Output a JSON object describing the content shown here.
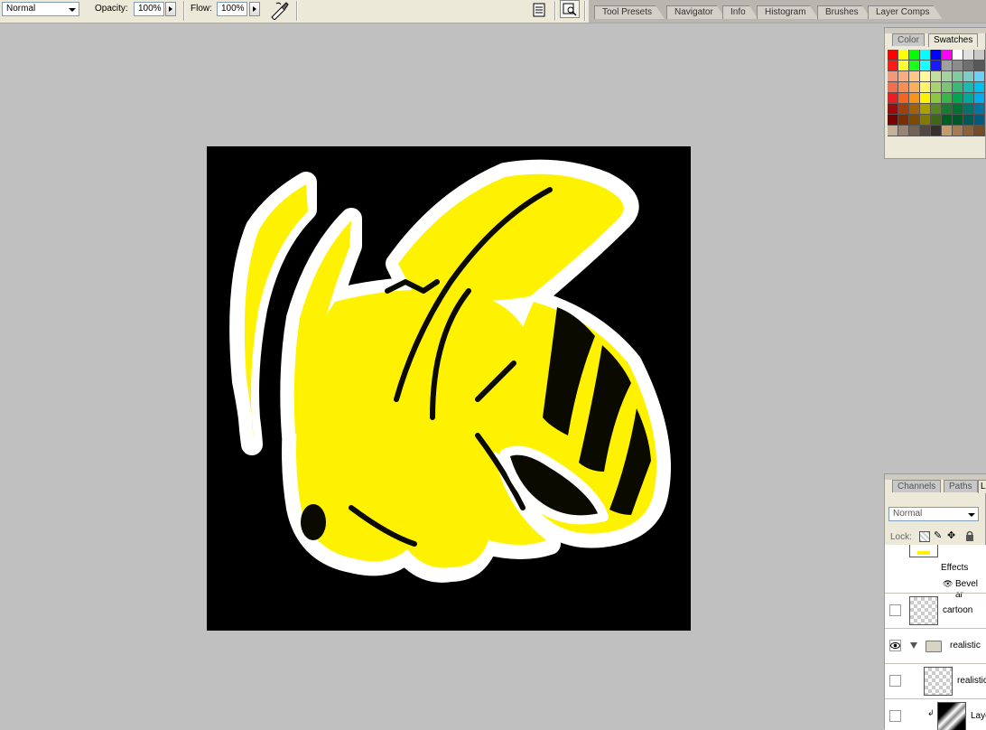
{
  "options_bar": {
    "mode_value": "Normal",
    "opacity_label": "Opacity:",
    "opacity_value": "100%",
    "flow_label": "Flow:",
    "flow_value": "100%",
    "icons": [
      "airbrush-icon",
      "palette-toggle-icon",
      "file-browser-icon"
    ]
  },
  "palette_well": {
    "tabs": [
      "Tool Presets",
      "Navigator",
      "Info",
      "Histogram",
      "Brushes",
      "Layer Comps"
    ]
  },
  "document": {
    "background": "#000000",
    "artwork": "bee-illustration"
  },
  "color_panel": {
    "tabs": [
      "Color",
      "Swatches"
    ],
    "active_tab": "Swatches",
    "swatches": [
      [
        "#ff0000",
        "#ffff00",
        "#00ff00",
        "#00ffff",
        "#0000ff",
        "#ff00ff",
        "#ffffff",
        "#e0e0e0",
        "#c8c8c8"
      ],
      [
        "#ff1a1a",
        "#ffff33",
        "#1aff1a",
        "#1affff",
        "#1a1aff",
        "#a0a0a0",
        "#8c8c8c",
        "#707070",
        "#585858"
      ],
      [
        "#f7977a",
        "#fbad82",
        "#fdc68a",
        "#fff79a",
        "#c4df9b",
        "#a2d39c",
        "#82ca9d",
        "#7bcdc8",
        "#6ecff6"
      ],
      [
        "#f26c4f",
        "#f68e55",
        "#fbaf5c",
        "#fff467",
        "#acd372",
        "#7cc576",
        "#3bb878",
        "#1abbb4",
        "#00bff3"
      ],
      [
        "#ed1c24",
        "#f26522",
        "#f7941d",
        "#fff200",
        "#8dc73f",
        "#39b54a",
        "#00a651",
        "#00a99d",
        "#00aeef"
      ],
      [
        "#9e0b0f",
        "#a0410d",
        "#a36209",
        "#aba000",
        "#598527",
        "#1a7b30",
        "#007236",
        "#00746b",
        "#0076a3"
      ],
      [
        "#790000",
        "#7b2e00",
        "#7d4900",
        "#827b00",
        "#406618",
        "#005e20",
        "#005826",
        "#005952",
        "#005b7f"
      ],
      [
        "#c7b299",
        "#998675",
        "#736357",
        "#534741",
        "#37302d",
        "#c69c6d",
        "#a67c52",
        "#8c6239",
        "#754c24"
      ]
    ]
  },
  "layers_panel": {
    "tabs": [
      "Channels",
      "Paths",
      "L"
    ],
    "blend_mode": "Normal",
    "lock_label": "Lock:",
    "rows": {
      "effects": "Effects",
      "bevel": "Bevel ar",
      "cartoon": "cartoon",
      "realistic_group": "realistic",
      "realistic_layer": "realistic",
      "layer_bottom": "Laye"
    }
  }
}
